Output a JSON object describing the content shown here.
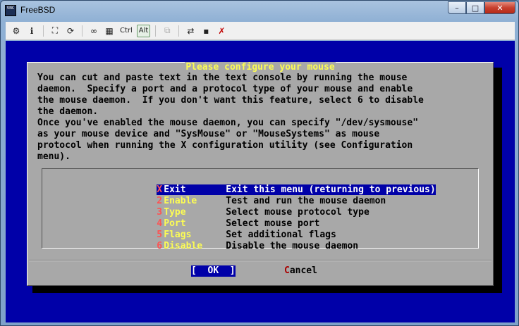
{
  "window": {
    "title": "FreeBSD",
    "app_icon": "VNC",
    "buttons": {
      "minimize": "–",
      "maximize": "□",
      "close": "✕"
    }
  },
  "toolbar": {
    "items": [
      {
        "name": "options-icon",
        "glyph": "⚙"
      },
      {
        "name": "info-icon",
        "glyph": "ℹ"
      },
      {
        "name": "fullscreen-icon",
        "glyph": "⛶"
      },
      {
        "name": "refresh-icon",
        "glyph": "⟳"
      },
      {
        "name": "ctrl-alt-del-icon",
        "glyph": "∞"
      },
      {
        "name": "start-menu-icon",
        "glyph": "▦"
      },
      {
        "name": "ctrl-key",
        "glyph": "Ctrl"
      },
      {
        "name": "alt-key",
        "glyph": "Alt"
      },
      {
        "name": "clipboard-icon",
        "glyph": "⧉"
      },
      {
        "name": "transfer-icon",
        "glyph": "⇄"
      },
      {
        "name": "save-icon",
        "glyph": "▪"
      },
      {
        "name": "disconnect-icon",
        "glyph": "✗"
      }
    ]
  },
  "dialog": {
    "title": "Please configure your mouse",
    "body": "You can cut and paste text in the text console by running the mouse\ndaemon.  Specify a port and a protocol type of your mouse and enable\nthe mouse daemon.  If you don't want this feature, select 6 to disable\nthe daemon.\nOnce you've enabled the mouse daemon, you can specify \"/dev/sysmouse\"\nas your mouse device and \"SysMouse\" or \"MouseSystems\" as mouse\nprotocol when running the X configuration utility (see Configuration\nmenu).",
    "menu": [
      {
        "key": "X",
        "name": "Exit",
        "desc": "Exit this menu (returning to previous)",
        "selected": true
      },
      {
        "key": "2",
        "name": "Enable",
        "desc": "Test and run the mouse daemon"
      },
      {
        "key": "3",
        "name": "Type",
        "desc": "Select mouse protocol type"
      },
      {
        "key": "4",
        "name": "Port",
        "desc": "Select mouse port"
      },
      {
        "key": "5",
        "name": "Flags",
        "desc": "Set additional flags"
      },
      {
        "key": "6",
        "name": "Disable",
        "desc": "Disable the mouse daemon"
      }
    ],
    "buttons": {
      "ok": {
        "pre": "[  ",
        "hot": "O",
        "post": "K  ]"
      },
      "cancel": {
        "hot": "C",
        "post": "ancel"
      }
    }
  },
  "colors": {
    "console_bg": "#0000a8",
    "dialog_bg": "#a8a8a8",
    "title_yellow": "#fcfc54",
    "hotkey_red": "#fc5454"
  }
}
